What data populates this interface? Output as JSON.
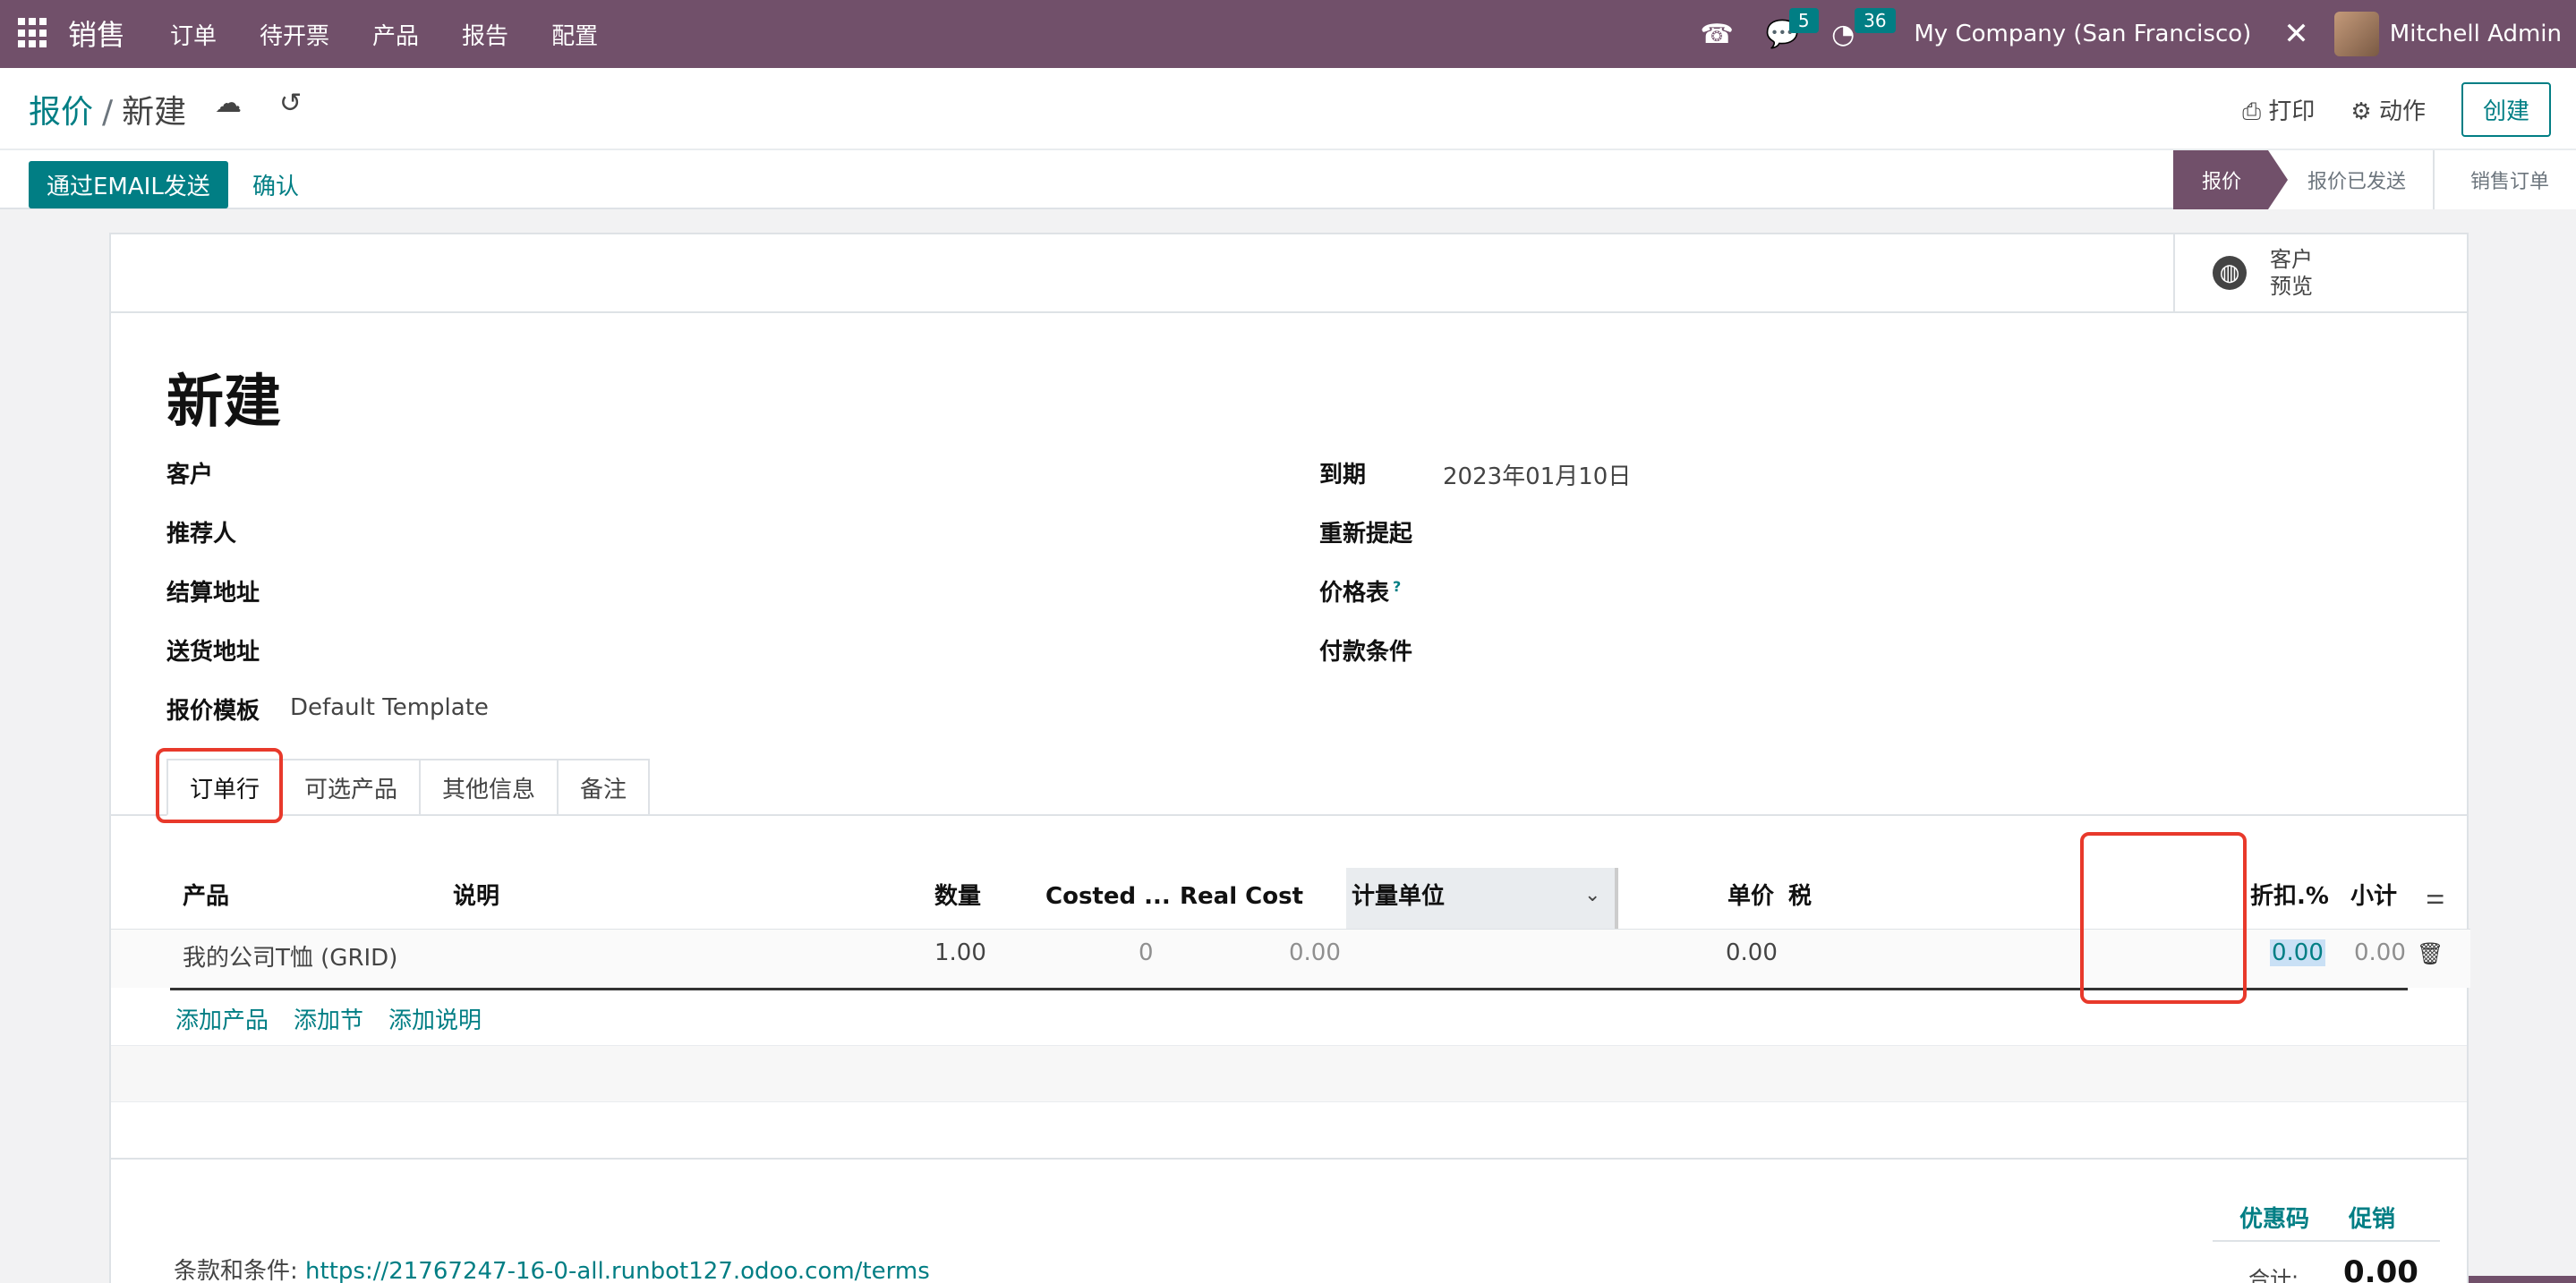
{
  "navbar": {
    "app_title": "销售",
    "menu": [
      "订单",
      "待开票",
      "产品",
      "报告",
      "配置"
    ],
    "chat_count": "5",
    "activity_count": "36",
    "company": "My Company (San Francisco)",
    "user": "Mitchell Admin"
  },
  "breadcrumb": {
    "parent": "报价",
    "separator": "/",
    "current": "新建"
  },
  "control": {
    "print": "打印",
    "action": "动作",
    "create": "创建"
  },
  "statusbar": {
    "send_email": "通过EMAIL发送",
    "confirm": "确认",
    "stages": [
      "报价",
      "报价已发送",
      "销售订单"
    ],
    "active_stage": "报价"
  },
  "sheet": {
    "preview_label_1": "客户",
    "preview_label_2": "预览",
    "title": "新建",
    "left_fields": {
      "customer": "客户",
      "referrer": "推荐人",
      "invoice_address": "结算地址",
      "delivery_address": "送货地址",
      "template_label": "报价模板",
      "template_value": "Default Template"
    },
    "right_fields": {
      "expiration_label": "到期",
      "expiration_value": "2023年01月10日",
      "reminder": "重新提起",
      "pricelist": "价格表",
      "pricelist_help": "?",
      "payment_terms": "付款条件"
    },
    "tabs": [
      "订单行",
      "可选产品",
      "其他信息",
      "备注"
    ],
    "table": {
      "headers": {
        "product": "产品",
        "description": "说明",
        "quantity": "数量",
        "costed": "Costed ...",
        "real_cost": "Real Cost",
        "uom": "计量单位",
        "unit_price": "单价",
        "tax": "税",
        "discount": "折扣.%",
        "subtotal": "小计"
      },
      "rows": [
        {
          "product": "我的公司T恤 (GRID)",
          "quantity": "1.00",
          "costed": "0",
          "real_cost": "0.00",
          "unit_price": "0.00",
          "discount": "0.00",
          "subtotal": "0.00"
        }
      ]
    },
    "add_links": [
      "添加产品",
      "添加节",
      "添加说明"
    ],
    "terms_label": "条款和条件:",
    "terms_url": "https://21767247-16-0-all.runbot127.odoo.com/terms",
    "promo": [
      "优惠码",
      "促销"
    ],
    "total_label": "合计:",
    "total_value": "0.00"
  },
  "colors": {
    "brand": "#71506a",
    "accent": "#017e84",
    "highlight": "#e8392b"
  }
}
